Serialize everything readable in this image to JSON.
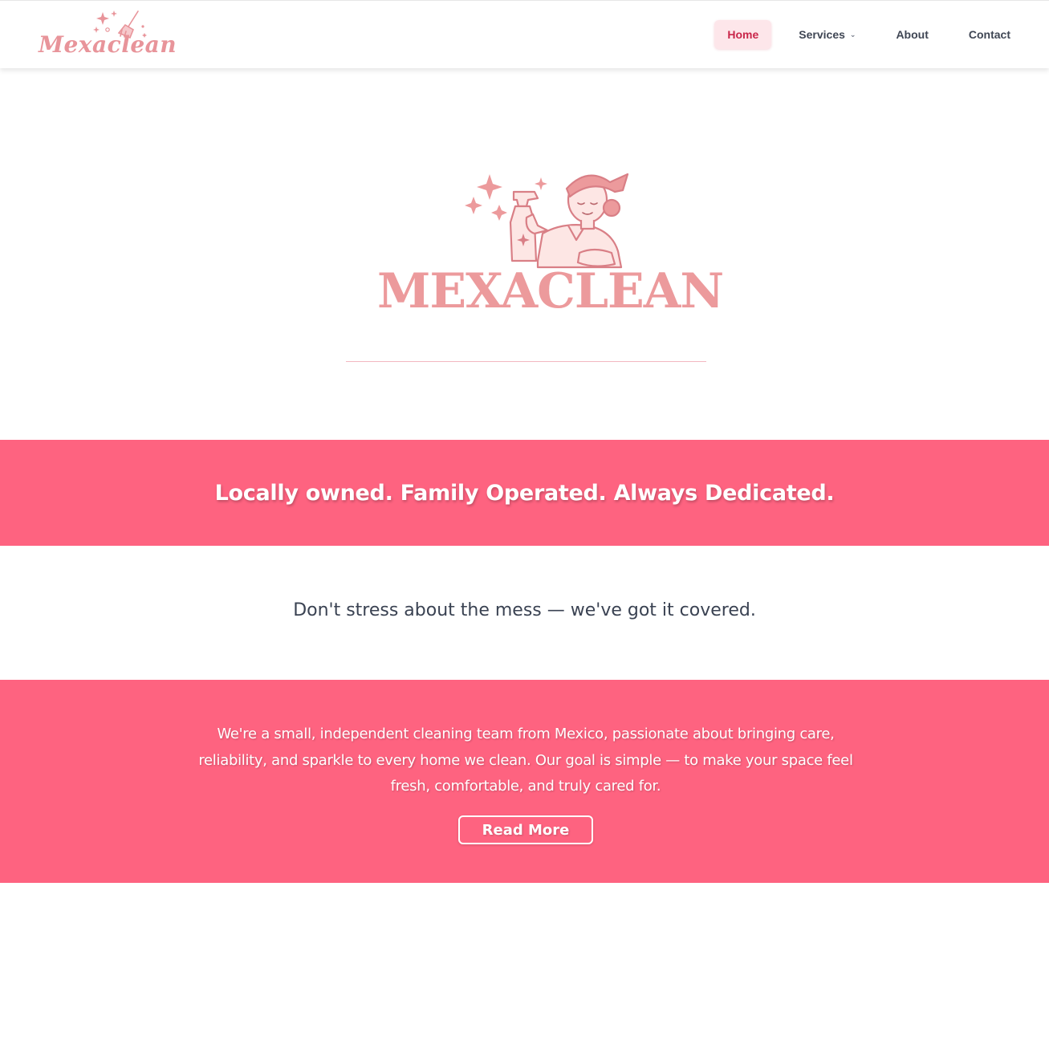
{
  "brand": {
    "name": "Mexaclean",
    "hero_wordmark": "MEXACLEAN",
    "accent_color": "#fe6380",
    "logo_color": "#ec9a9c"
  },
  "nav": {
    "items": [
      {
        "label": "Home",
        "active": true
      },
      {
        "label": "Services",
        "has_dropdown": true,
        "icon": "chevron-down-icon"
      },
      {
        "label": "About"
      },
      {
        "label": "Contact"
      }
    ]
  },
  "banner": {
    "headline": "Locally owned. Family Operated. Always Dedicated."
  },
  "tagline": "Don't stress about the mess — we've got it covered.",
  "about": {
    "text": "We're a small, independent cleaning team from Mexico, passionate about bringing care, reliability, and sparkle to every home we clean. Our goal is simple — to make your space feel fresh, comfortable, and truly cared for.",
    "button_label": "Read More"
  }
}
